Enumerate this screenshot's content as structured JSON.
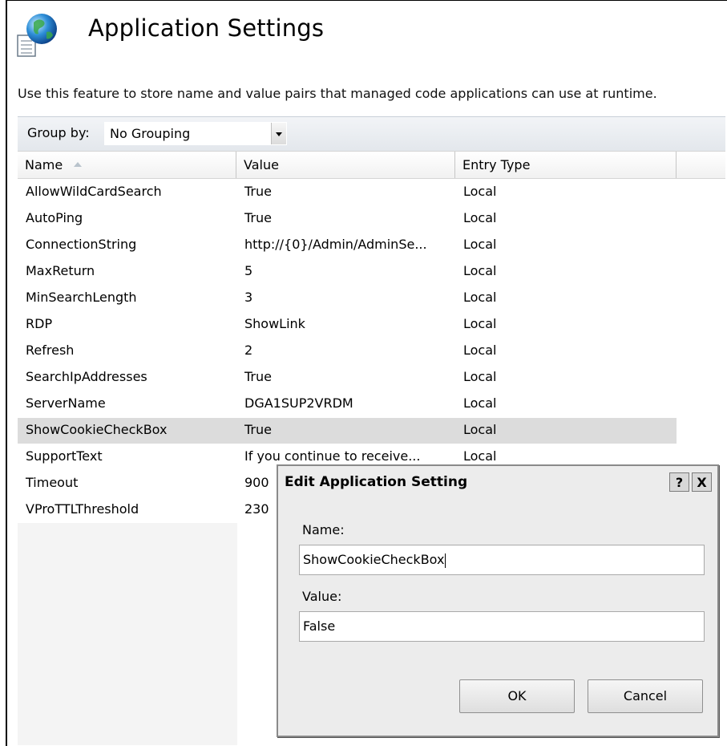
{
  "page": {
    "title": "Application Settings",
    "icon": "application-settings-icon",
    "description": "Use this feature to store name and value pairs that managed code applications can use at runtime."
  },
  "group_by": {
    "label": "Group by:",
    "value": "No Grouping"
  },
  "table": {
    "columns": [
      "Name",
      "Value",
      "Entry Type"
    ],
    "sorted_column": "Name",
    "sort_direction": "ascending",
    "selected_row": "ShowCookieCheckBox",
    "rows": [
      {
        "name": "AllowWildCardSearch",
        "value": "True",
        "entry_type": "Local"
      },
      {
        "name": "AutoPing",
        "value": "True",
        "entry_type": "Local"
      },
      {
        "name": "ConnectionString",
        "value": "http://{0}/Admin/AdminSe...",
        "entry_type": "Local"
      },
      {
        "name": "MaxReturn",
        "value": "5",
        "entry_type": "Local"
      },
      {
        "name": "MinSearchLength",
        "value": "3",
        "entry_type": "Local"
      },
      {
        "name": "RDP",
        "value": "ShowLink",
        "entry_type": "Local"
      },
      {
        "name": "Refresh",
        "value": "2",
        "entry_type": "Local"
      },
      {
        "name": "SearchIpAddresses",
        "value": "True",
        "entry_type": "Local"
      },
      {
        "name": "ServerName",
        "value": "DGA1SUP2VRDM",
        "entry_type": "Local"
      },
      {
        "name": "ShowCookieCheckBox",
        "value": "True",
        "entry_type": "Local"
      },
      {
        "name": "SupportText",
        "value": "If you continue to receive...",
        "entry_type": "Local"
      },
      {
        "name": "Timeout",
        "value": "900",
        "entry_type": ""
      },
      {
        "name": "VProTTLThreshold",
        "value": "230",
        "entry_type": ""
      }
    ]
  },
  "dialog": {
    "title": "Edit Application Setting",
    "help_label": "?",
    "close_label": "X",
    "name_label": "Name:",
    "name_value": "ShowCookieCheckBox",
    "value_label": "Value:",
    "value_value": "False",
    "ok_label": "OK",
    "cancel_label": "Cancel"
  },
  "colors": {
    "selected_row": "#dcdcdc",
    "dialog_bg": "#ececec",
    "group_bar": "#e3e7ec"
  }
}
